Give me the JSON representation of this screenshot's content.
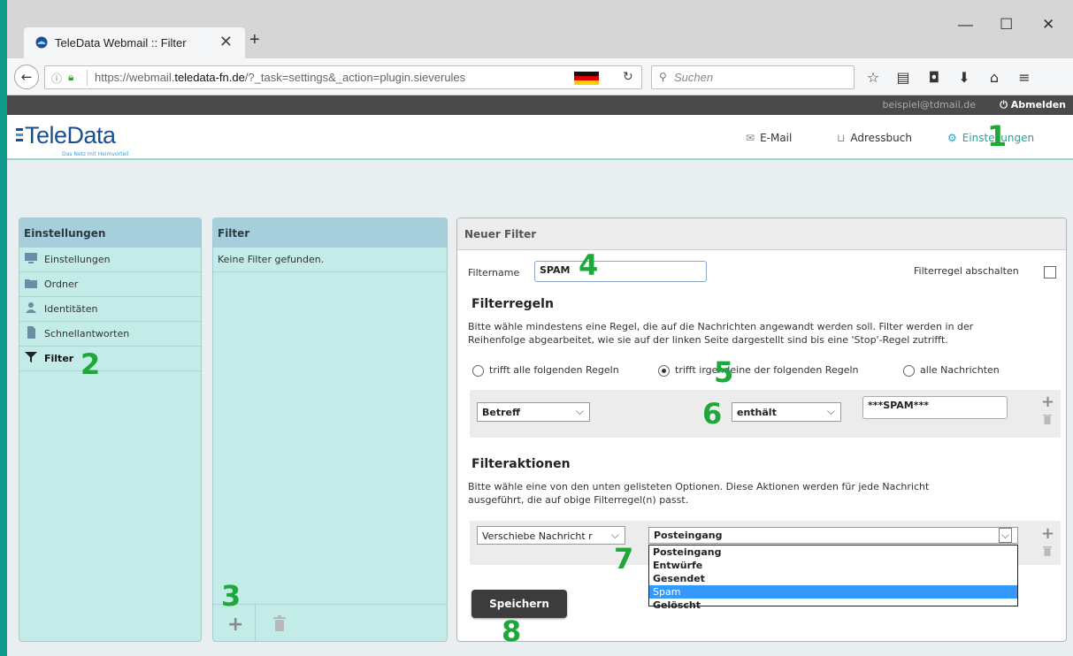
{
  "browser": {
    "tab_title": "TeleData Webmail :: Filter",
    "tab_close": "✕",
    "new_tab": "+",
    "url_prefix": "https://webmail.",
    "url_domain": "teledata-fn.de",
    "url_path": "/?_task=settings&_action=plugin.sieverules",
    "search_placeholder": "Suchen",
    "window_buttons": {
      "minimize": "—",
      "maximize": "☐",
      "close": "✕"
    }
  },
  "top": {
    "user": "beispiel@tdmail.de",
    "logout": "Abmelden"
  },
  "logo": {
    "name_part1": "Tele",
    "name_part2": "Data",
    "tagline": "Das Netz mit Heimvorteil"
  },
  "header_nav": {
    "email": "E-Mail",
    "addressbook": "Adressbuch",
    "settings": "Einstellungen"
  },
  "settings_panel": {
    "title": "Einstellungen",
    "items": [
      "Einstellungen",
      "Ordner",
      "Identitäten",
      "Schnellantworten",
      "Filter"
    ]
  },
  "filter_panel": {
    "title": "Filter",
    "empty": "Keine Filter gefunden."
  },
  "new_filter": {
    "title": "Neuer Filter",
    "name_label": "Filtername",
    "name_value": "SPAM",
    "disable_label": "Filterregel abschalten",
    "rules_heading": "Filterregeln",
    "rules_text_1": "Bitte wähle mindestens eine Regel, die auf die Nachrichten angewandt werden soll. Filter werden in der",
    "rules_text_2": "Reihenfolge abgearbeitet, wie sie auf der linken Seite dargestellt sind bis eine 'Stop'-Regel zutrifft.",
    "radio_all": "trifft alle folgenden Regeln",
    "radio_any": "trifft irgendeine der folgenden Regeln",
    "radio_messages": "alle Nachrichten",
    "rule_field": "Betreff",
    "rule_op": "enthält",
    "rule_value": "***SPAM***",
    "actions_heading": "Filteraktionen",
    "actions_text_1": "Bitte wähle eine von den unten gelisteten Optionen. Diese Aktionen werden für jede Nachricht",
    "actions_text_2": "ausgeführt, die auf obige Filterregel(n) passt.",
    "action_select": "Verschiebe Nachricht r",
    "folder_select": "Posteingang",
    "folder_options": [
      "Posteingang",
      "Entwürfe",
      "Gesendet",
      "Spam",
      "Gelöscht"
    ],
    "save": "Speichern"
  },
  "callouts": [
    "1",
    "2",
    "3",
    "4",
    "5",
    "6",
    "7",
    "8"
  ],
  "colors": {
    "accent": "#1fa83a",
    "teal": "#0f9a8c",
    "highlight": "#3399ff"
  }
}
